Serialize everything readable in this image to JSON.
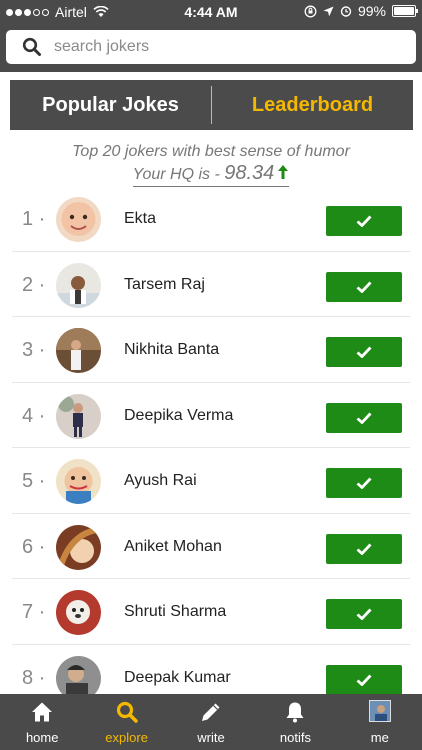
{
  "status": {
    "carrier": "Airtel",
    "time": "4:44 AM",
    "battery": "99%"
  },
  "search": {
    "placeholder": "search jokers"
  },
  "tabs": [
    {
      "label": "Popular Jokes",
      "active": false
    },
    {
      "label": "Leaderboard",
      "active": true
    }
  ],
  "header": {
    "subtitle": "Top 20 jokers with best sense of humor",
    "hq_label": "Your HQ is - ",
    "hq_value": "98.34"
  },
  "leaderboard": [
    {
      "rank": "1",
      "name": "Ekta"
    },
    {
      "rank": "2",
      "name": "Tarsem Raj"
    },
    {
      "rank": "3",
      "name": "Nikhita Banta"
    },
    {
      "rank": "4",
      "name": "Deepika Verma"
    },
    {
      "rank": "5",
      "name": "Ayush Rai"
    },
    {
      "rank": "6",
      "name": "Aniket Mohan"
    },
    {
      "rank": "7",
      "name": "Shruti Sharma"
    },
    {
      "rank": "8",
      "name": "Deepak Kumar"
    }
  ],
  "nav": [
    {
      "label": "home",
      "icon": "home-icon"
    },
    {
      "label": "explore",
      "icon": "search-icon",
      "active": true
    },
    {
      "label": "write",
      "icon": "pencil-icon"
    },
    {
      "label": "notifs",
      "icon": "bell-icon"
    },
    {
      "label": "me",
      "icon": "profile-avatar"
    }
  ],
  "colors": {
    "bar": "#4a4a4a",
    "accent": "#f5b800",
    "follow_green": "#1e8b16"
  }
}
